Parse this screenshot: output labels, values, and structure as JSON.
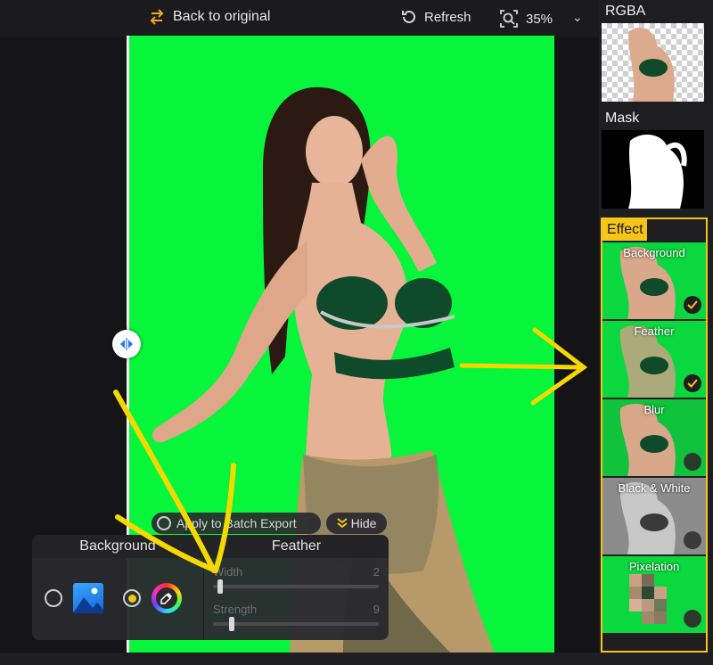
{
  "toolbar": {
    "back_label": "Back to original",
    "refresh_label": "Refresh",
    "zoom_value": "35%"
  },
  "apply": {
    "label": "Apply to Batch Export"
  },
  "hide": {
    "label": "Hide"
  },
  "panel": {
    "background_title": "Background",
    "feather_title": "Feather",
    "width_label": "Width",
    "width_value": "2",
    "strength_label": "Strength",
    "strength_value": "9"
  },
  "sidebar": {
    "rgba_label": "RGBA",
    "mask_label": "Mask",
    "effect_label": "Effect",
    "effects": [
      {
        "label": "Background",
        "checked": true
      },
      {
        "label": "Feather",
        "checked": true
      },
      {
        "label": "Blur",
        "checked": false
      },
      {
        "label": "Black & White",
        "checked": false
      },
      {
        "label": "Pixelation",
        "checked": false
      }
    ]
  },
  "colors": {
    "accent": "#f5c518",
    "canvas_green": "#07f53a"
  }
}
